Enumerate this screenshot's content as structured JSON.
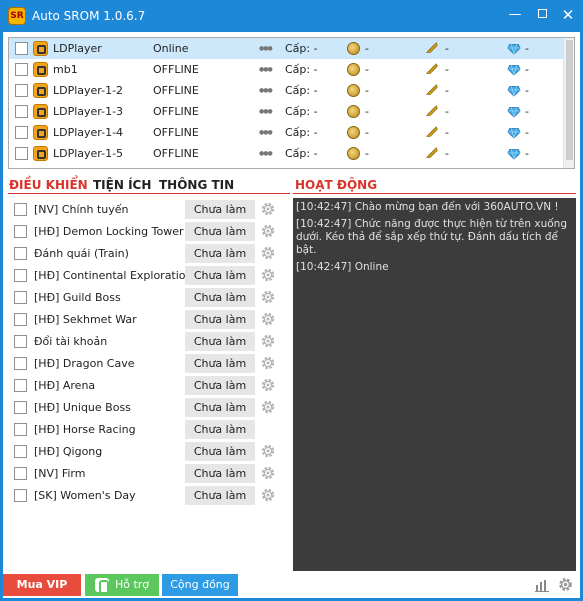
{
  "window": {
    "title": "Auto SROM 1.0.6.7",
    "logo_text": "SR",
    "min": "—",
    "close": "✕"
  },
  "devices": [
    {
      "name": "LDPlayer",
      "status": "Online",
      "level": "Cấp: -",
      "gold": "-",
      "wing": "-",
      "gem": "-",
      "selected": true
    },
    {
      "name": "mb1",
      "status": "OFFLINE",
      "level": "Cấp: -",
      "gold": "-",
      "wing": "-",
      "gem": "-"
    },
    {
      "name": "LDPlayer-1-2",
      "status": "OFFLINE",
      "level": "Cấp: -",
      "gold": "-",
      "wing": "-",
      "gem": "-"
    },
    {
      "name": "LDPlayer-1-3",
      "status": "OFFLINE",
      "level": "Cấp: -",
      "gold": "-",
      "wing": "-",
      "gem": "-"
    },
    {
      "name": "LDPlayer-1-4",
      "status": "OFFLINE",
      "level": "Cấp: -",
      "gold": "-",
      "wing": "-",
      "gem": "-"
    },
    {
      "name": "LDPlayer-1-5",
      "status": "OFFLINE",
      "level": "Cấp: -",
      "gold": "-",
      "wing": "-",
      "gem": "-"
    }
  ],
  "tabs": [
    {
      "label": "ĐIỀU KHIỂN",
      "active": true
    },
    {
      "label": "TIỆN ÍCH"
    },
    {
      "label": "THÔNG TIN"
    }
  ],
  "activity": {
    "title": "HOẠT ĐỘNG",
    "lines": [
      "[10:42:47] Chào mừng bạn đến với 360AUTO.VN !",
      "[10:42:47] Chức năng được thực hiện từ trên xuống dưới. Kéo thả để sắp xếp thứ tự. Đánh dấu tích để bật.",
      "[10:42:47] Online"
    ]
  },
  "tasks": [
    {
      "name": "[NV] Chính tuyến",
      "status": "Chưa làm",
      "gear": true
    },
    {
      "name": "[HĐ] Demon Locking Tower",
      "status": "Chưa làm",
      "gear": true
    },
    {
      "name": "Đánh quái (Train)",
      "status": "Chưa làm",
      "gear": true
    },
    {
      "name": "[HĐ] Continental Exploration",
      "status": "Chưa làm",
      "gear": true
    },
    {
      "name": "[HĐ] Guild Boss",
      "status": "Chưa làm",
      "gear": true
    },
    {
      "name": "[HĐ] Sekhmet War",
      "status": "Chưa làm",
      "gear": true
    },
    {
      "name": "Đổi tài khoản",
      "status": "Chưa làm",
      "gear": true
    },
    {
      "name": "[HĐ] Dragon Cave",
      "status": "Chưa làm",
      "gear": true
    },
    {
      "name": "[HĐ] Arena",
      "status": "Chưa làm",
      "gear": true
    },
    {
      "name": "[HĐ] Unique Boss",
      "status": "Chưa làm",
      "gear": true
    },
    {
      "name": "[HĐ] Horse Racing",
      "status": "Chưa làm",
      "gear": false
    },
    {
      "name": "[HĐ] Qigong",
      "status": "Chưa làm",
      "gear": true
    },
    {
      "name": "[NV] Firm",
      "status": "Chưa làm",
      "gear": true
    },
    {
      "name": "[SK] Women's Day",
      "status": "Chưa làm",
      "gear": true
    }
  ],
  "footer": {
    "vip_label": "Mua VIP",
    "help_label": "Hỗ trợ",
    "community_label": "Cộng đồng"
  },
  "colors": {
    "title_bar": "#1e88d8",
    "accent_red": "#d9342b",
    "log_bg": "#3c3c3c",
    "vip": "#e74c3c",
    "help": "#5cc75c",
    "community": "#2e9be5"
  }
}
